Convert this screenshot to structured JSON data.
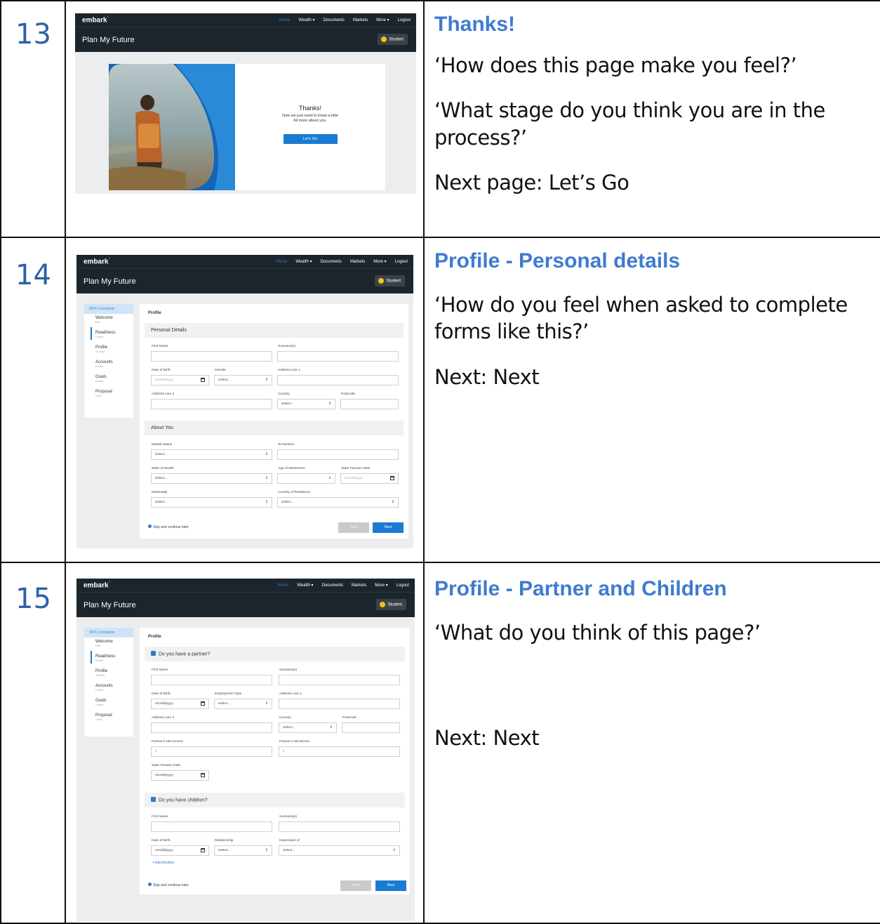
{
  "rows": [
    {
      "step": "13",
      "title": "Thanks!",
      "notes": [
        "‘How does this page make you feel?’",
        "‘What stage do you think you are in the process?’",
        "Next page: Let’s Go"
      ],
      "mock": {
        "brand": "embark",
        "nav": [
          "Home",
          "Wealth ▾",
          "Documents",
          "Markets",
          "More ▾",
          "Logout"
        ],
        "page_title": "Plan My Future",
        "badge": "Student",
        "card_heading": "Thanks!",
        "card_text": "Now we just need to know a little bit more about you.",
        "card_button": "Let's Go"
      }
    },
    {
      "step": "14",
      "title": "Profile - Personal details",
      "notes": [
        "‘How do you feel when asked to complete forms like this?’",
        "Next: Next"
      ],
      "mock": {
        "brand": "embark",
        "nav": [
          "Home",
          "Wealth ▾",
          "Documents",
          "Markets",
          "More ▾",
          "Logout"
        ],
        "page_title": "Plan My Future",
        "badge": "Student",
        "progress": "36% Complete",
        "steps": [
          {
            "label": "Welcome",
            "time": "Edit"
          },
          {
            "label": "Readiness",
            "time": "5 mins"
          },
          {
            "label": "Profile",
            "time": "10 mins"
          },
          {
            "label": "Accounts",
            "time": "5 mins"
          },
          {
            "label": "Goals",
            "time": "5 mins"
          },
          {
            "label": "Proposal",
            "time": "1 min"
          }
        ],
        "card_title": "Profile",
        "section1": "Personal Details",
        "section2": "About You",
        "labels": {
          "first_name": "First Name",
          "surname": "Surname(s)",
          "dob": "Date of Birth",
          "gender": "Gender",
          "address1": "Address Line 1",
          "address2": "Address Line 2",
          "country": "Country",
          "postcode": "Postcode",
          "marital": "Martial Status",
          "ni": "NI Number",
          "health": "State of Health",
          "retirement": "Age of Retirement",
          "pension": "State Pension Date",
          "nationality": "Nationality",
          "residence": "Country of Residence"
        },
        "date_placeholder": "mm/dd/yyyy",
        "select_placeholder": "Select...",
        "skip": "Skip and continue later",
        "back": "Back",
        "next": "Next"
      }
    },
    {
      "step": "15",
      "title": "Profile - Partner and Children",
      "notes": [
        "‘What do you think of this page?’",
        "Next: Next"
      ],
      "mock": {
        "brand": "embark",
        "nav": [
          "Home",
          "Wealth ▾",
          "Documents",
          "Markets",
          "More ▾",
          "Logout"
        ],
        "page_title": "Plan My Future",
        "badge": "Student",
        "progress": "36% Complete",
        "steps": [
          {
            "label": "Welcome",
            "time": "Edit"
          },
          {
            "label": "Readiness",
            "time": "5 mins"
          },
          {
            "label": "Profile",
            "time": "10 mins"
          },
          {
            "label": "Accounts",
            "time": "5 mins"
          },
          {
            "label": "Goals",
            "time": "5 mins"
          },
          {
            "label": "Proposal",
            "time": "1 min"
          }
        ],
        "card_title": "Profile",
        "section1": "Do you have a partner?",
        "section2": "Do you have children?",
        "labels": {
          "first_name": "First Name",
          "surname": "Surname(s)",
          "dob": "Date of Birth",
          "employment": "Employment Type",
          "address1": "Address Line 1",
          "address2": "Address Line 2",
          "country": "Country",
          "postcode": "Postcode",
          "net_income": "Partner's Net Income",
          "net_bonus": "Partner's Net Bonus",
          "pension": "State Pension Date",
          "relationship": "Relationship",
          "dependant": "Dependant of"
        },
        "currency": "£",
        "date_placeholder": "mm/dd/yyyy",
        "select_placeholder": "Select...",
        "add_another": "+ Add Another",
        "skip": "Skip and continue later",
        "back": "Back",
        "next": "Next"
      }
    }
  ]
}
